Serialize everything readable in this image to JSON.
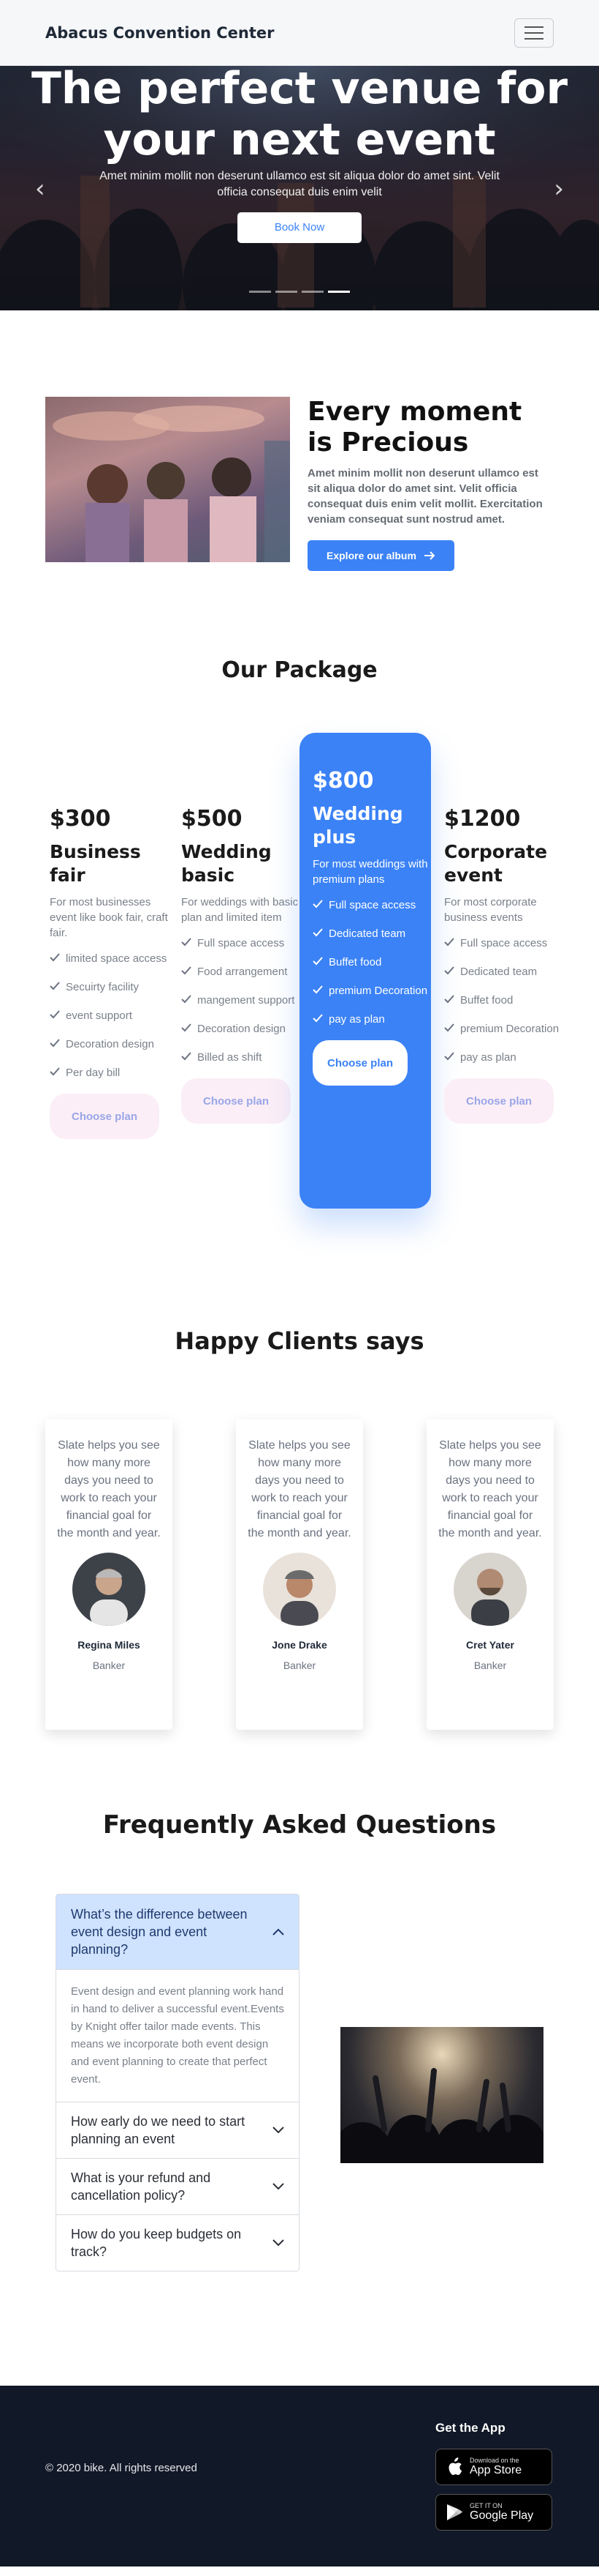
{
  "navbar": {
    "brand": "Abacus Convention Center"
  },
  "hero": {
    "title": "The perfect venue for your next event",
    "text": "Amet minim mollit non deserunt ullamco est sit aliqua dolor do amet sint. Velit officia consequat duis enim velit",
    "button": "Book Now",
    "slides": 4,
    "active_slide": 4
  },
  "moment": {
    "title": "Every moment is Precious",
    "text": "Amet minim mollit non deserunt ullamco est sit aliqua dolor do amet sint. Velit officia consequat duis enim velit mollit. Exercitation veniam consequat sunt nostrud amet.",
    "button": "Explore our album"
  },
  "packages": {
    "title": "Our Package",
    "items": [
      {
        "price": "$300",
        "name": "Business fair",
        "desc": "For most businesses event like book fair, craft fair.",
        "features": [
          "limited space access",
          "Secuirty facility",
          "event support",
          "Decoration design",
          "Per day bill"
        ],
        "button": "Choose plan"
      },
      {
        "price": "$500",
        "name": "Wedding basic",
        "desc": "For weddings with basic plan and limited item",
        "features": [
          "Full space access",
          "Food arrangement",
          "mangement support",
          "Decoration design",
          "Billed as shift"
        ],
        "button": "Choose plan"
      },
      {
        "price": "$800",
        "name": "Wedding plus",
        "desc": "For most weddings with premium plans",
        "features": [
          "Full space access",
          "Dedicated team",
          "Buffet food",
          "premium Decoration",
          "pay as plan"
        ],
        "button": "Choose plan"
      },
      {
        "price": "$1200",
        "name": "Corporate event",
        "desc": "For most corporate business events",
        "features": [
          "Full space access",
          "Dedicated team",
          "Buffet food",
          "premium Decoration",
          "pay as plan"
        ],
        "button": "Choose plan"
      }
    ]
  },
  "clients": {
    "title": "Happy Clients says",
    "items": [
      {
        "quote": "Slate helps you see how many more days you need to work to reach your financial goal for the month and year.",
        "name": "Regina Miles",
        "role": "Banker"
      },
      {
        "quote": "Slate helps you see how many more days you need to work to reach your financial goal for the month and year.",
        "name": "Jone Drake",
        "role": "Banker"
      },
      {
        "quote": "Slate helps you see how many more days you need to work to reach your financial goal for the month and year.",
        "name": "Cret Yater",
        "role": "Banker"
      }
    ]
  },
  "faq": {
    "title": "Frequently Asked Questions",
    "items": [
      {
        "q": "What’s the difference between event design and event planning?",
        "a": "Event design and event planning work hand in hand to deliver a successful event.Events by Knight offer tailor made events. This means we incorporate both event design and event planning to create that perfect event."
      },
      {
        "q": "How early do we need to start planning an event"
      },
      {
        "q": "What is your refund and cancellation policy?"
      },
      {
        "q": "How do you keep budgets on track?"
      }
    ]
  },
  "footer": {
    "copyright": "© 2020 bike. All rights reserved",
    "get_app": "Get the App",
    "apple_small": "Download on the",
    "apple_big": "App Store",
    "google_small": "GET IT ON",
    "google_big": "Google Play"
  },
  "colors": {
    "accent": "#3b82f6",
    "footer": "#111827",
    "faq_open": "#cfe2fe"
  }
}
